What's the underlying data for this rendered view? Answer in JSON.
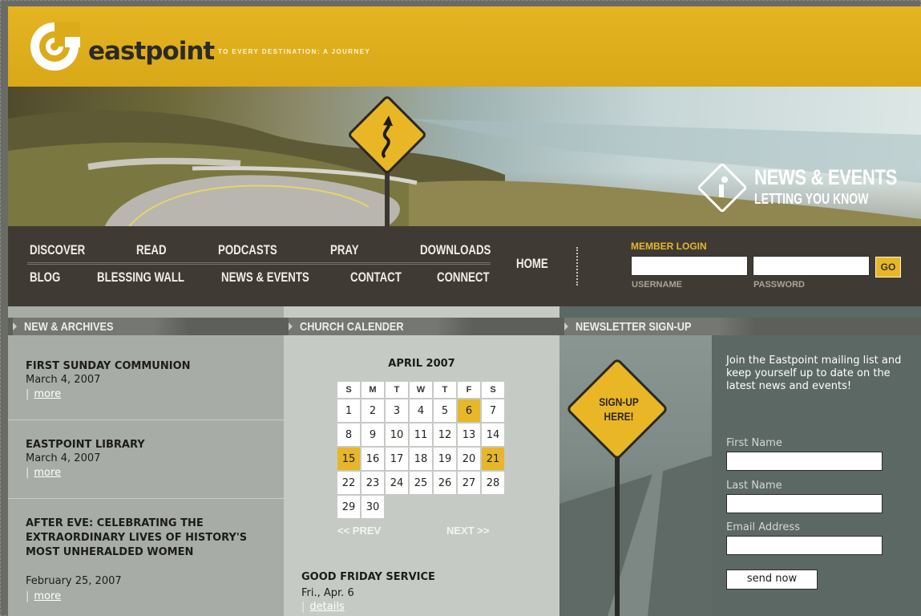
{
  "header": {
    "logo_text": "eastpoint",
    "tagline": "TO EVERY DESTINATION: A JOURNEY"
  },
  "banner": {
    "title": "NEWS & EVENTS",
    "subtitle": "LETTING YOU KNOW"
  },
  "nav": {
    "row1": [
      "DISCOVER",
      "READ",
      "PODCASTS",
      "PRAY",
      "DOWNLOADS"
    ],
    "row2": [
      "BLOG",
      "BLESSING WALL",
      "NEWS & EVENTS",
      "CONTACT",
      "CONNECT"
    ],
    "home": "HOME"
  },
  "login": {
    "title": "MEMBER LOGIN",
    "username_label": "USERNAME",
    "password_label": "PASSWORD",
    "go_label": "GO"
  },
  "news": {
    "heading": "NEW & ARCHIVES",
    "items": [
      {
        "title": "FIRST SUNDAY COMMUNION",
        "date": "March 4, 2007",
        "link": "more"
      },
      {
        "title": "EASTPOINT LIBRARY",
        "date": "March 4, 2007",
        "link": "more"
      },
      {
        "title": "AFTER EVE: CELEBRATING THE EXTRAORDINARY LIVES OF HISTORY'S MOST UNHERALDED WOMEN",
        "date": "February 25, 2007",
        "link": "more"
      }
    ],
    "pipe": "|"
  },
  "calendar": {
    "heading": "CHURCH CALENDER",
    "month": "APRIL 2007",
    "weekdays": [
      "S",
      "M",
      "T",
      "W",
      "T",
      "F",
      "S"
    ],
    "weeks": [
      [
        "1",
        "2",
        "3",
        "4",
        "5",
        "6",
        "7"
      ],
      [
        "8",
        "9",
        "10",
        "11",
        "12",
        "13",
        "14"
      ],
      [
        "15",
        "16",
        "17",
        "18",
        "19",
        "20",
        "21"
      ],
      [
        "22",
        "23",
        "24",
        "25",
        "26",
        "27",
        "28"
      ],
      [
        "29",
        "30",
        "",
        "",
        "",
        "",
        ""
      ]
    ],
    "highlighted": [
      "6",
      "15",
      "21"
    ],
    "prev": "<< PREV",
    "next": "NEXT >>",
    "event_title": "GOOD FRIDAY SERVICE",
    "event_date": "Fri., Apr. 6",
    "event_link": "details",
    "pipe": "|"
  },
  "newsletter": {
    "heading": "NEWSLETTER SIGN-UP",
    "sign_text": "SIGN-UP HERE!",
    "intro": "Join the Eastpoint mailing list and keep yourself up to date on the latest news and events!",
    "first_name_label": "First Name",
    "last_name_label": "Last Name",
    "email_label": "Email Address",
    "send_label": "send now"
  },
  "colors": {
    "brand_yellow": "#e7b629",
    "nav_bg": "#3f3b34",
    "panel_gray": "#a8aca7"
  }
}
